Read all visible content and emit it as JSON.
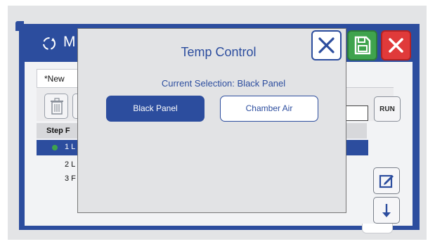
{
  "app": {
    "title": "M",
    "tab_label": "*New",
    "run_label": "RUN",
    "table": {
      "header_step": "Step F",
      "rows": [
        {
          "label": "1 L",
          "selected": true,
          "status_color": "#3fa34d"
        },
        {
          "label": "2 L",
          "selected": false
        },
        {
          "label": "3 F",
          "selected": false
        }
      ]
    },
    "icons": {
      "app": "refresh-icon",
      "trash": "trash-icon",
      "edit": "edit-icon",
      "down": "arrow-down-icon"
    }
  },
  "modal": {
    "title": "Temp Control",
    "selection_text": "Current Selection: Black Panel",
    "options": [
      {
        "label": "Black Panel",
        "selected": true
      },
      {
        "label": "Chamber Air",
        "selected": false
      }
    ],
    "actions": {
      "close": "close-icon",
      "save": "save-icon",
      "cancel": "cancel-icon"
    }
  },
  "colors": {
    "accent": "#2c4d9e",
    "save": "#3fa34d",
    "cancel": "#e03a3a",
    "background": "#e3e4e6"
  }
}
